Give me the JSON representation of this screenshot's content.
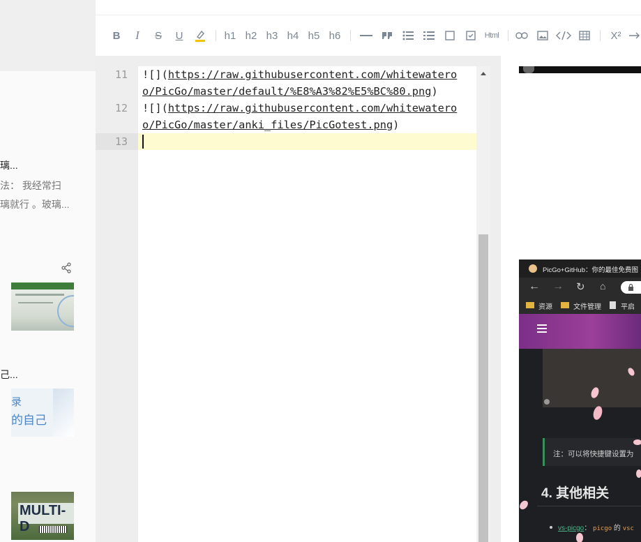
{
  "feed": {
    "item1_title": "璃...",
    "item1_summary_line1": "法：  我经常扫",
    "item1_summary_line2": "璃就行 。玻璃...",
    "item2_title": "己...",
    "thumb2_text_line1": "录",
    "thumb2_text_line2": "的自己",
    "thumb3_text": "MULTI-D"
  },
  "toolbar": {
    "bold": "B",
    "italic": "I",
    "strike": "S",
    "underline": "U",
    "h1": "h1",
    "h2": "h2",
    "h3": "h3",
    "h4": "h4",
    "h5": "h5",
    "h6": "h6",
    "html": "Html",
    "superscript": "X²"
  },
  "editor": {
    "lines": [
      {
        "number": "11",
        "prefix": "![](",
        "url_part1": "https://raw.githubusercontent.com/whitewatero",
        "url_part2": "o/PicGo/master/default/%E8%A3%82%E5%BC%80.png",
        "suffix": ")"
      },
      {
        "number": "12",
        "prefix": "![](",
        "url_part1": "https://raw.githubusercontent.com/whitewatero",
        "url_part2": "o/PicGo/master/anki_files/PicGotest.png",
        "suffix": ")"
      },
      {
        "number": "13"
      }
    ]
  },
  "preview": {
    "browser_tab_title": "PicGo+GitHub：你的最佳免费图",
    "bookmark1": "资源",
    "bookmark2": "文件管理",
    "bookmark3": "平启",
    "note_text": "注：可以将快捷键设置为",
    "heading": "4. 其他相关",
    "bullet_link": "vs-picgo",
    "bullet_code": "picgo",
    "bullet_text_a": "：",
    "bullet_text_b": "的",
    "bullet_text_c": "vsc"
  }
}
